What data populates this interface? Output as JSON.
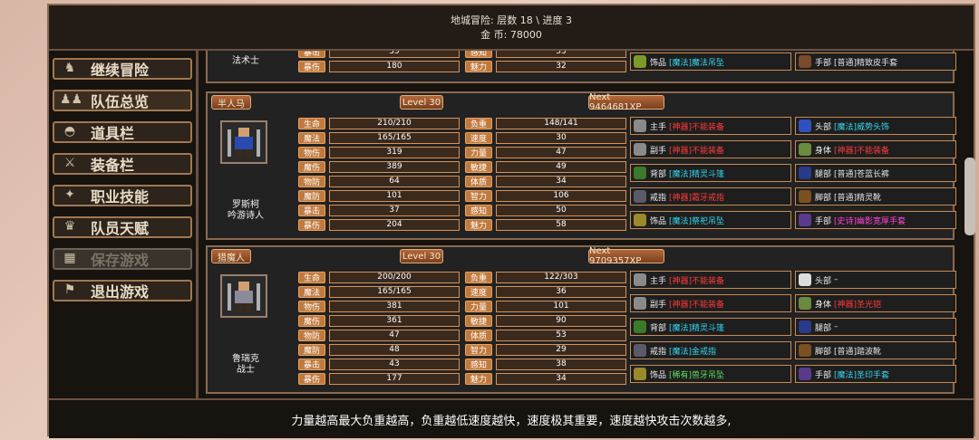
{
  "header": {
    "line1": "地城冒险: 层数 18 \\ 进度 3",
    "gold_label": "金    币:",
    "gold_value": "78000"
  },
  "menu": [
    {
      "label": "继续冒险",
      "icon": "dragon-icon"
    },
    {
      "label": "队伍总览",
      "icon": "party-icon"
    },
    {
      "label": "道具栏",
      "icon": "bag-icon"
    },
    {
      "label": "装备栏",
      "icon": "equipment-icon"
    },
    {
      "label": "职业技能",
      "icon": "skill-icon"
    },
    {
      "label": "队员天赋",
      "icon": "talent-icon"
    },
    {
      "label": "保存游戏",
      "icon": "save-icon"
    },
    {
      "label": "退出游戏",
      "icon": "exit-icon"
    }
  ],
  "partial": {
    "job": "法术士",
    "r1": {
      "l1": "暴击",
      "v1": "35",
      "l2": "感知",
      "v2": "53"
    },
    "r2": {
      "l1": "暴伤",
      "v1": "180",
      "l2": "魅力",
      "v2": "32"
    },
    "eq1": {
      "slot": "饰品",
      "tier": "[魔法]",
      "name": "魔法吊坠"
    },
    "eq2": {
      "slot": "手部",
      "tier": "[普通]",
      "name": "精致皮手套"
    }
  },
  "chars": [
    {
      "race": "半人马",
      "level": "Level 30",
      "next": "Next 9464681XP",
      "name": "罗斯柯",
      "job": "吟游诗人",
      "stats": [
        [
          "生命",
          "210/210",
          "负重",
          "148/141"
        ],
        [
          "魔法",
          "165/165",
          "速度",
          "30"
        ],
        [
          "物伤",
          "319",
          "力量",
          "47"
        ],
        [
          "魔伤",
          "389",
          "敏捷",
          "49"
        ],
        [
          "物防",
          "64",
          "体质",
          "34"
        ],
        [
          "魔防",
          "101",
          "智力",
          "106"
        ],
        [
          "暴击",
          "37",
          "感知",
          "50"
        ],
        [
          "暴伤",
          "204",
          "魅力",
          "58"
        ]
      ],
      "equip": [
        [
          {
            "slot": "主手",
            "tier": "[神器]",
            "name": "不能装备",
            "cls": "red",
            "icon": "sword-icon"
          },
          {
            "slot": "头部",
            "tier": "[魔法]",
            "name": "威势头饰",
            "cls": "magic",
            "icon": "helmet-icon"
          }
        ],
        [
          {
            "slot": "副手",
            "tier": "[神器]",
            "name": "不能装备",
            "cls": "red",
            "icon": "sword-icon"
          },
          {
            "slot": "身体",
            "tier": "[神器]",
            "name": "不能装备",
            "cls": "red",
            "icon": "armor-icon"
          }
        ],
        [
          {
            "slot": "背部",
            "tier": "[魔法]",
            "name": "精灵斗篷",
            "cls": "magic",
            "icon": "cloak-icon"
          },
          {
            "slot": "腿部",
            "tier": "[普通]",
            "name": "苍蓝长裤",
            "cls": "normal",
            "icon": "pants-icon"
          }
        ],
        [
          {
            "slot": "戒指",
            "tier": "[神器]",
            "name": "霜牙戒指",
            "cls": "red",
            "icon": "ring-icon"
          },
          {
            "slot": "脚部",
            "tier": "[普通]",
            "name": "精灵靴",
            "cls": "normal",
            "icon": "boots-icon"
          }
        ],
        [
          {
            "slot": "饰品",
            "tier": "[魔法]",
            "name": "祭祀吊坠",
            "cls": "magic",
            "icon": "amulet-icon"
          },
          {
            "slot": "手部",
            "tier": "[史诗]",
            "name": "幽影宽厚手套",
            "cls": "epic",
            "icon": "gloves-icon"
          }
        ]
      ]
    },
    {
      "race": "猎魔人",
      "level": "Level 30",
      "next": "Next 9709357XP",
      "name": "鲁瑞克",
      "job": "战士",
      "stats": [
        [
          "生命",
          "200/200",
          "负重",
          "122/303"
        ],
        [
          "魔法",
          "165/165",
          "速度",
          "36"
        ],
        [
          "物伤",
          "381",
          "力量",
          "101"
        ],
        [
          "魔伤",
          "361",
          "敏捷",
          "90"
        ],
        [
          "物防",
          "47",
          "体质",
          "53"
        ],
        [
          "魔防",
          "48",
          "智力",
          "29"
        ],
        [
          "暴击",
          "43",
          "感知",
          "38"
        ],
        [
          "暴伤",
          "177",
          "魅力",
          "34"
        ]
      ],
      "equip": [
        [
          {
            "slot": "主手",
            "tier": "[神器]",
            "name": "不能装备",
            "cls": "red",
            "icon": "sword-icon"
          },
          {
            "slot": "头部",
            "tier": "",
            "name": "–",
            "cls": "normal",
            "icon": "skull-icon"
          }
        ],
        [
          {
            "slot": "副手",
            "tier": "[神器]",
            "name": "不能装备",
            "cls": "red",
            "icon": "sword-icon"
          },
          {
            "slot": "身体",
            "tier": "[神器]",
            "name": "圣光铠",
            "cls": "red",
            "icon": "armor-icon"
          }
        ],
        [
          {
            "slot": "背部",
            "tier": "[魔法]",
            "name": "精灵斗篷",
            "cls": "magic",
            "icon": "cloak-icon"
          },
          {
            "slot": "腿部",
            "tier": "",
            "name": "–",
            "cls": "normal",
            "icon": "pants-icon"
          }
        ],
        [
          {
            "slot": "戒指",
            "tier": "[魔法]",
            "name": "金戒指",
            "cls": "magic",
            "icon": "ring-icon"
          },
          {
            "slot": "脚部",
            "tier": "[普通]",
            "name": "踏波靴",
            "cls": "normal",
            "icon": "boots-icon"
          }
        ],
        [
          {
            "slot": "饰品",
            "tier": "[稀有]",
            "name": "兽牙吊坠",
            "cls": "rare",
            "icon": "amulet-icon"
          },
          {
            "slot": "手部",
            "tier": "[魔法]",
            "name": "圣印手套",
            "cls": "magic",
            "icon": "gloves-icon"
          }
        ]
      ]
    }
  ],
  "hint": "力量越高最大负重越高，负重越低速度越快，速度极其重要，速度越快攻击次数越多,"
}
